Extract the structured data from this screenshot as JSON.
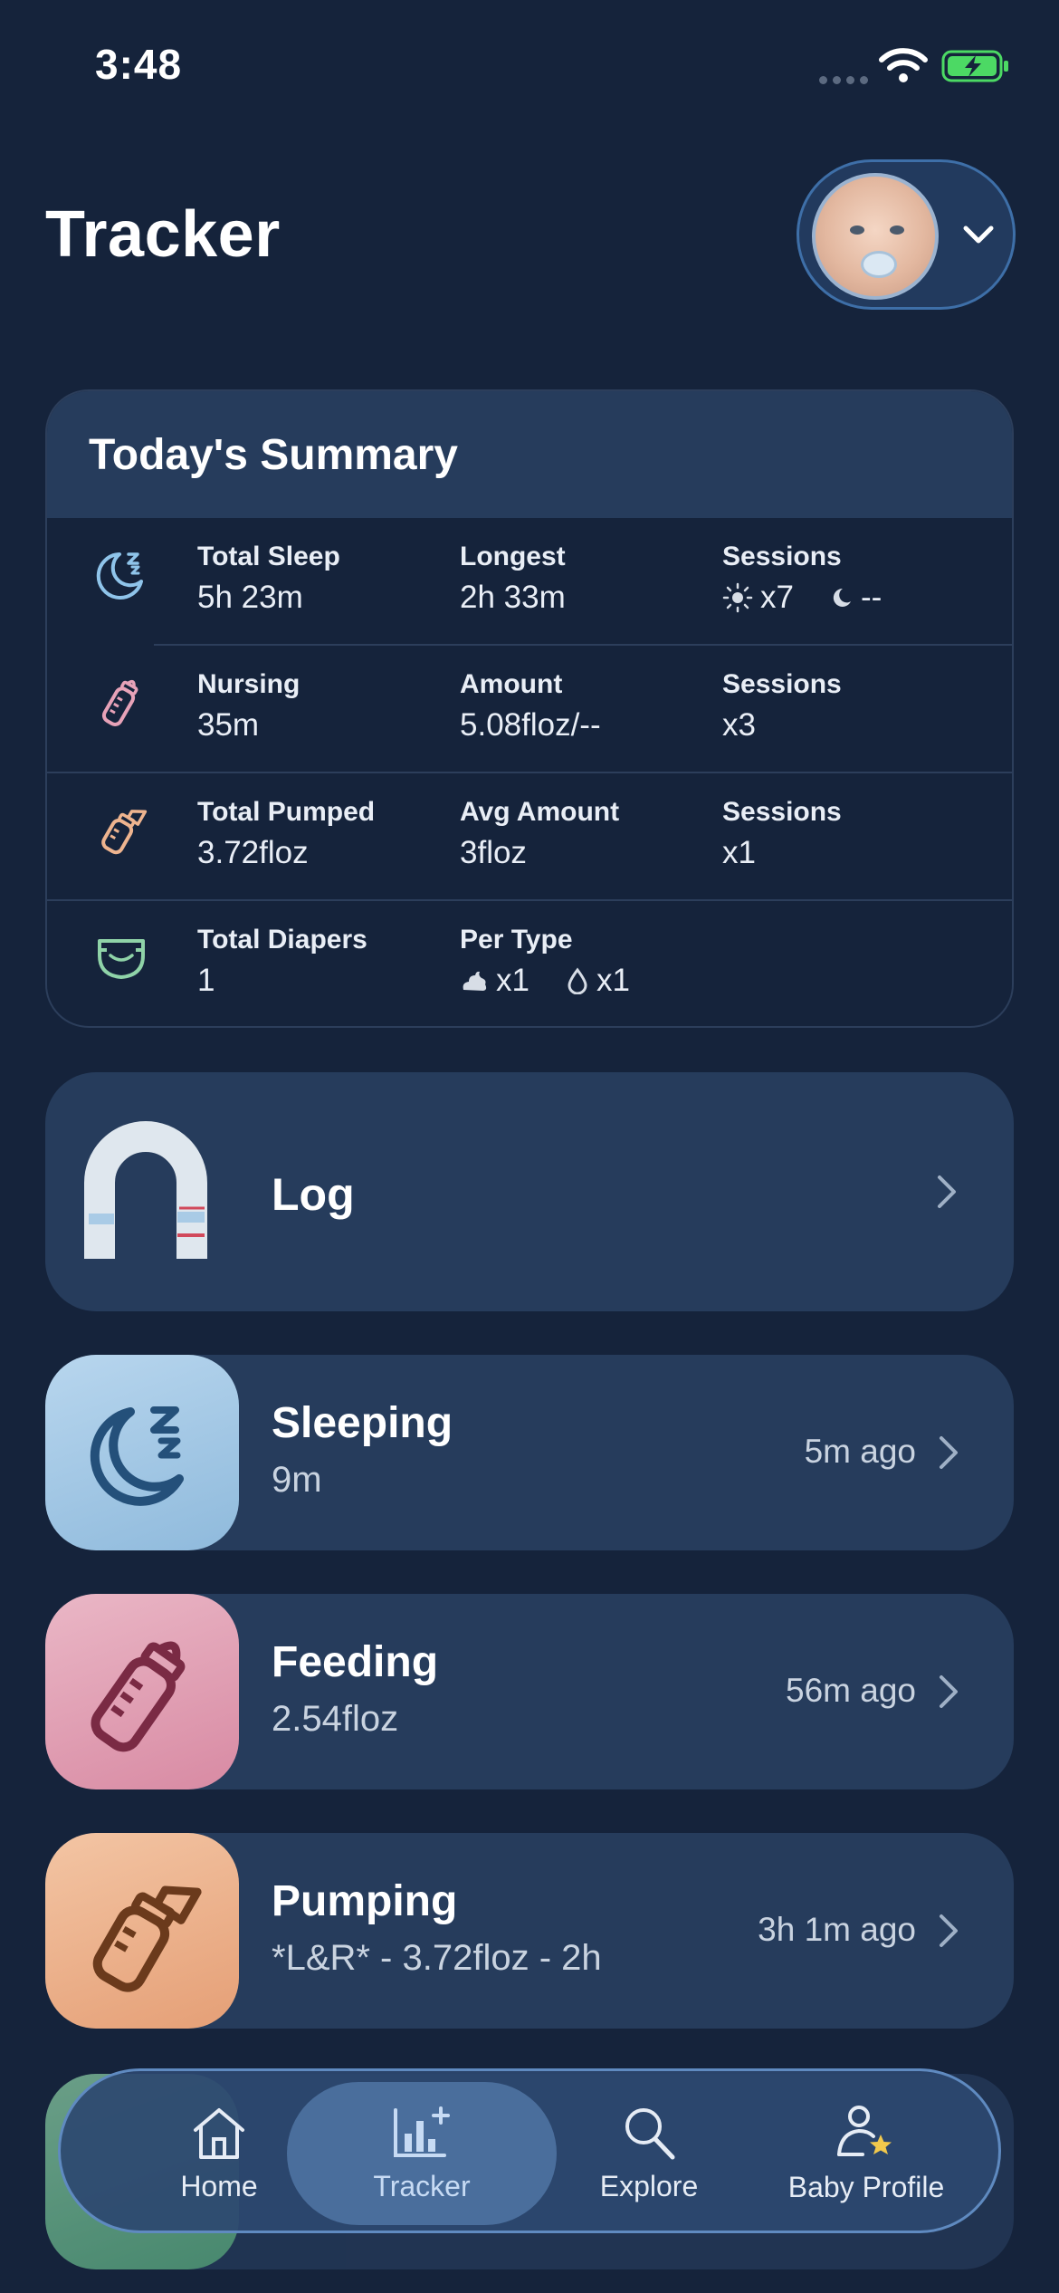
{
  "status": {
    "time": "3:48"
  },
  "header": {
    "title": "Tracker"
  },
  "summary": {
    "title": "Today's Summary",
    "sleep": {
      "total_label": "Total Sleep",
      "total_value": "5h 23m",
      "longest_label": "Longest",
      "longest_value": "2h 33m",
      "sessions_label": "Sessions",
      "day_count": "x7",
      "night_count": "--"
    },
    "nursing": {
      "label": "Nursing",
      "value": "35m",
      "amount_label": "Amount",
      "amount_value": "5.08floz/--",
      "sessions_label": "Sessions",
      "sessions_value": "x3"
    },
    "pumped": {
      "label": "Total Pumped",
      "value": "3.72floz",
      "avg_label": "Avg Amount",
      "avg_value": "3floz",
      "sessions_label": "Sessions",
      "sessions_value": "x1"
    },
    "diapers": {
      "label": "Total Diapers",
      "value": "1",
      "type_label": "Per Type",
      "dirty_count": "x1",
      "wet_count": "x1"
    }
  },
  "log": {
    "label": "Log"
  },
  "activities": [
    {
      "title": "Sleeping",
      "subtitle": "9m",
      "time": "5m ago",
      "color": "#a9cbe6"
    },
    {
      "title": "Feeding",
      "subtitle": "2.54floz",
      "time": "56m ago",
      "color": "#e3a5b8"
    },
    {
      "title": "Pumping",
      "subtitle": "*L&R* - 3.72floz - 2h",
      "time": "3h 1m ago",
      "color": "#eeb48f"
    }
  ],
  "tabs": [
    {
      "label": "Home",
      "icon": "home-icon"
    },
    {
      "label": "Tracker",
      "icon": "chart-add-icon",
      "active": true
    },
    {
      "label": "Explore",
      "icon": "search-icon"
    },
    {
      "label": "Baby Profile",
      "icon": "person-star-icon"
    }
  ],
  "colors": {
    "background": "#15233b",
    "card": "#263c5c",
    "accent": "#4a6e9c"
  }
}
